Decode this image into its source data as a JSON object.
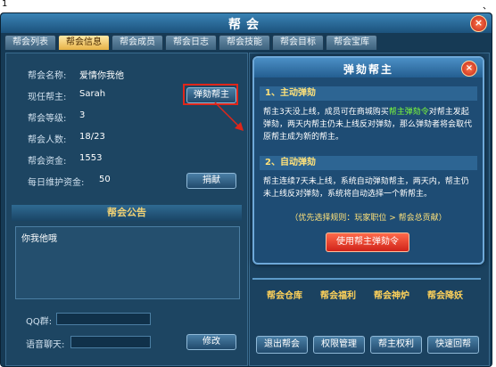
{
  "corner": {
    "number": "1",
    "mark": "、"
  },
  "window": {
    "title": "帮会",
    "close_icon": "×"
  },
  "tabs": [
    "帮会列表",
    "帮会信息",
    "帮会成员",
    "帮会日志",
    "帮会技能",
    "帮会目标",
    "帮会宝库"
  ],
  "active_tab": "帮会信息",
  "info": {
    "name_label": "帮会名称:",
    "name_value": "爱情你我他",
    "leader_label": "现任帮主:",
    "leader_value": "Sarah",
    "level_label": "帮会等级:",
    "level_value": "3",
    "members_label": "帮会人数:",
    "members_value": "18/23",
    "funds_label": "帮会资金:",
    "funds_value": "1553",
    "upkeep_label": "每日维护资金:",
    "upkeep_value": "50"
  },
  "buttons": {
    "impeach": "弹劾帮主",
    "donate": "捐献",
    "modify": "修改"
  },
  "notice": {
    "header": "帮会公告",
    "text": "你我他哦"
  },
  "contacts": {
    "qq_label": "QQ群:",
    "voice_label": "语音聊天:"
  },
  "popup": {
    "title": "弹劾帮主",
    "section1_title": "1、主动弹劾",
    "section1_text_a": "帮主3天没上线，成员可在商城购买",
    "section1_item": "帮主弹劾令",
    "section1_text_b": "对帮主发起弹劾，两天内帮主仍未上线反对弹劾，那么弹劾者将会取代原帮主成为新的帮主。",
    "section2_title": "2、自动弹劾",
    "section2_text": "帮主连续7天未上线，系统自动弹劾帮主，两天内，帮主仍未上线反对弹劾，系统将自动选择一个新帮主。",
    "rule": "（优先选择规则：玩家职位 > 帮会总贡献）",
    "use_button": "使用帮主弹劾令"
  },
  "features": [
    "帮会仓库",
    "帮会福利",
    "帮会神炉",
    "帮会降妖"
  ],
  "bottom_buttons": [
    "退出帮会",
    "权限管理",
    "帮主权利",
    "快速回帮"
  ]
}
